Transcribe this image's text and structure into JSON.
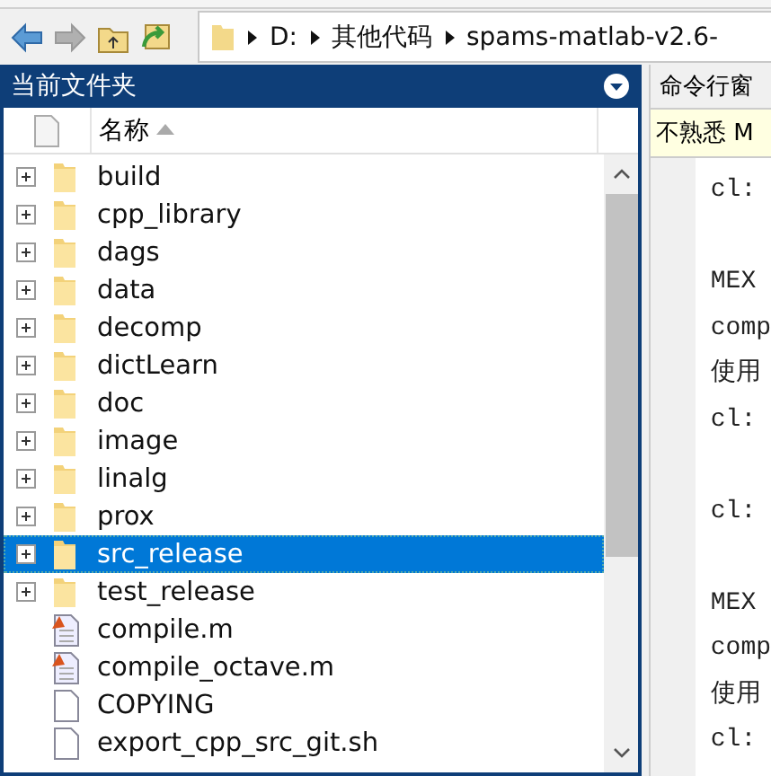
{
  "toolbar": {
    "path": [
      "D:",
      "其他代码",
      "spams-matlab-v2.6-"
    ]
  },
  "file_panel": {
    "title": "当前文件夹",
    "column": "名称",
    "files": [
      {
        "name": "build",
        "kind": "folder",
        "selected": false
      },
      {
        "name": "cpp_library",
        "kind": "folder",
        "selected": false
      },
      {
        "name": "dags",
        "kind": "folder",
        "selected": false
      },
      {
        "name": "data",
        "kind": "folder",
        "selected": false
      },
      {
        "name": "decomp",
        "kind": "folder",
        "selected": false
      },
      {
        "name": "dictLearn",
        "kind": "folder",
        "selected": false
      },
      {
        "name": "doc",
        "kind": "folder",
        "selected": false
      },
      {
        "name": "image",
        "kind": "folder",
        "selected": false
      },
      {
        "name": "linalg",
        "kind": "folder",
        "selected": false
      },
      {
        "name": "prox",
        "kind": "folder",
        "selected": false
      },
      {
        "name": "src_release",
        "kind": "folder",
        "selected": true
      },
      {
        "name": "test_release",
        "kind": "folder",
        "selected": false
      },
      {
        "name": "compile.m",
        "kind": "mfile",
        "selected": false
      },
      {
        "name": "compile_octave.m",
        "kind": "mfile",
        "selected": false
      },
      {
        "name": "COPYING",
        "kind": "file",
        "selected": false
      },
      {
        "name": "export_cpp_src_git.sh",
        "kind": "file",
        "selected": false
      }
    ]
  },
  "command_window": {
    "title": "命令行窗",
    "notice": "不熟悉 M",
    "blocks": [
      [
        "cl:"
      ],
      [
        "MEX",
        "comp",
        "使用",
        "cl:"
      ],
      [
        "cl:"
      ],
      [
        "MEX",
        "comp",
        "使用",
        "cl:"
      ]
    ]
  }
}
